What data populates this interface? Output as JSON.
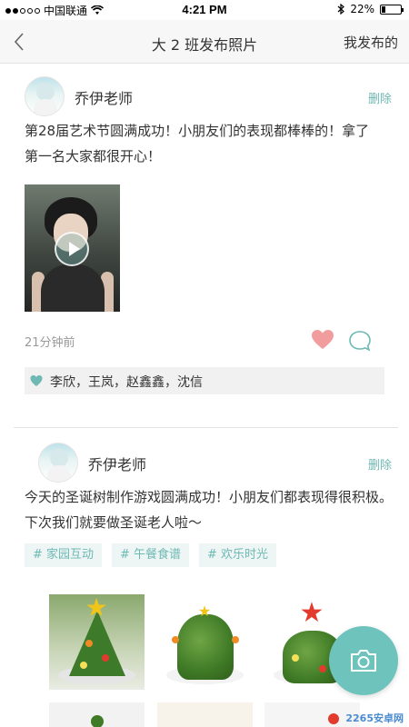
{
  "status_bar": {
    "carrier": "中国联通",
    "time": "4:21 PM",
    "battery": "22%",
    "battery_level": 0.22
  },
  "nav": {
    "title": "大 2 班发布照片",
    "action": "我发布的"
  },
  "posts": [
    {
      "author": "乔伊老师",
      "delete_label": "删除",
      "text_line1": "第28届艺术节圆满成功！小朋友们的表现都棒棒的！拿了",
      "text_line2": "第一名大家都很开心！",
      "time": "21分钟前",
      "likes": "李欣，王岚，赵鑫鑫，沈信"
    },
    {
      "author": "乔伊老师",
      "delete_label": "删除",
      "text_line1": "今天的圣诞树制作游戏圆满成功！小朋友们都表现得很积极。",
      "text_line2": "下次我们就要做圣诞老人啦～",
      "tags": [
        "# 家园互动",
        "# 午餐食谱",
        "# 欢乐时光"
      ]
    }
  ],
  "watermark": "2265安卓网",
  "colors": {
    "accent": "#6fb9b4",
    "heart": "#f19d9d",
    "fab": "#6fc3bd"
  },
  "icons": {
    "back": "chevron-left-icon",
    "heart": "heart-icon",
    "comment": "comment-icon",
    "camera": "camera-icon",
    "play": "play-icon"
  }
}
